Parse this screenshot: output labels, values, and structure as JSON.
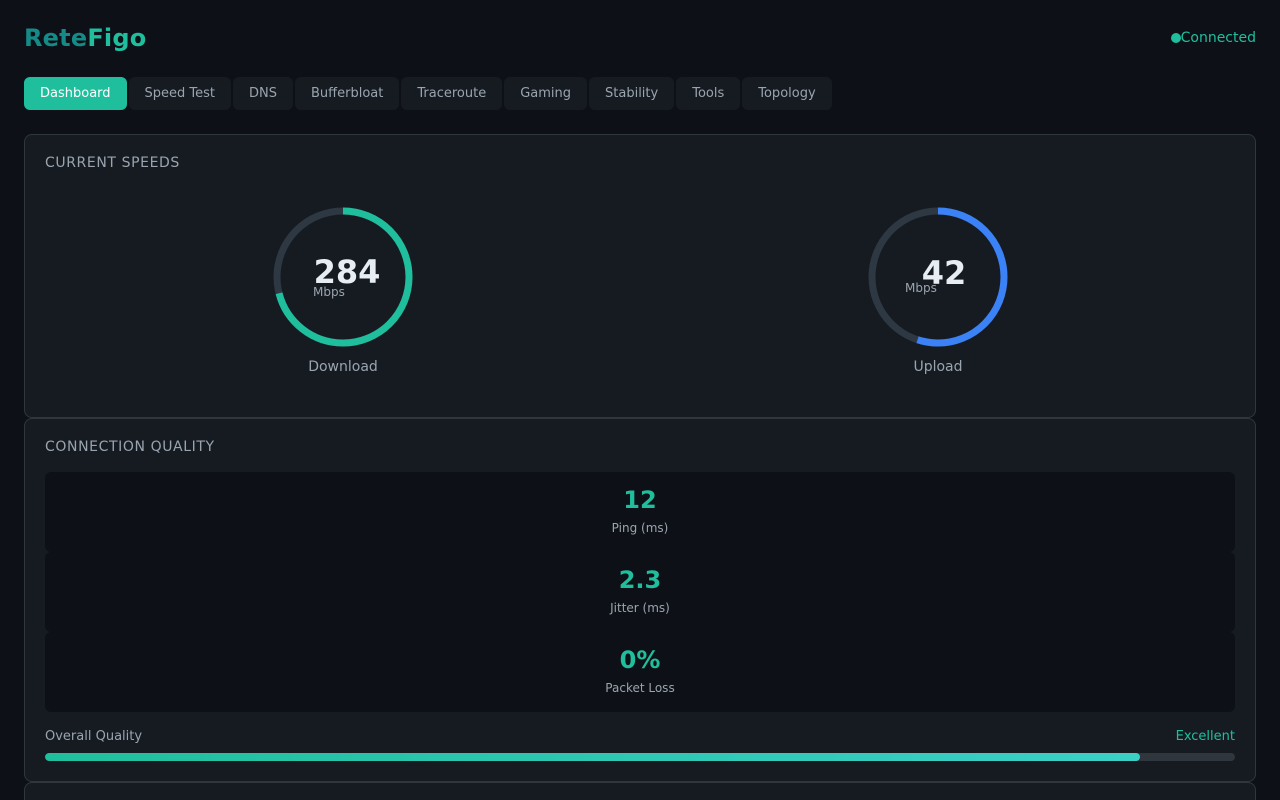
{
  "app": {
    "logo_part1": "Rete",
    "logo_part2": "Figo",
    "status": "Connected"
  },
  "tabs": [
    {
      "label": "Dashboard",
      "active": true
    },
    {
      "label": "Speed Test"
    },
    {
      "label": "DNS"
    },
    {
      "label": "Bufferbloat"
    },
    {
      "label": "Traceroute"
    },
    {
      "label": "Gaming"
    },
    {
      "label": "Stability"
    },
    {
      "label": "Tools"
    },
    {
      "label": "Topology"
    }
  ],
  "speeds": {
    "title": "CURRENT SPEEDS",
    "download": {
      "value": "284",
      "unit": "Mbps",
      "label": "Download",
      "fraction": 0.71,
      "color": "#1fbf9d"
    },
    "upload": {
      "value": "42",
      "unit": "Mbps",
      "label": "Upload",
      "fraction": 0.55,
      "color": "#3b82f6"
    },
    "track_color": "#2d3843"
  },
  "quality": {
    "title": "CONNECTION QUALITY",
    "metrics": [
      {
        "value": "12",
        "label": "Ping (ms)"
      },
      {
        "value": "2.3",
        "label": "Jitter (ms)"
      },
      {
        "value": "0%",
        "label": "Packet Loss"
      }
    ],
    "overall_label": "Overall Quality",
    "overall_rating": "Excellent",
    "overall_percent": 92
  }
}
